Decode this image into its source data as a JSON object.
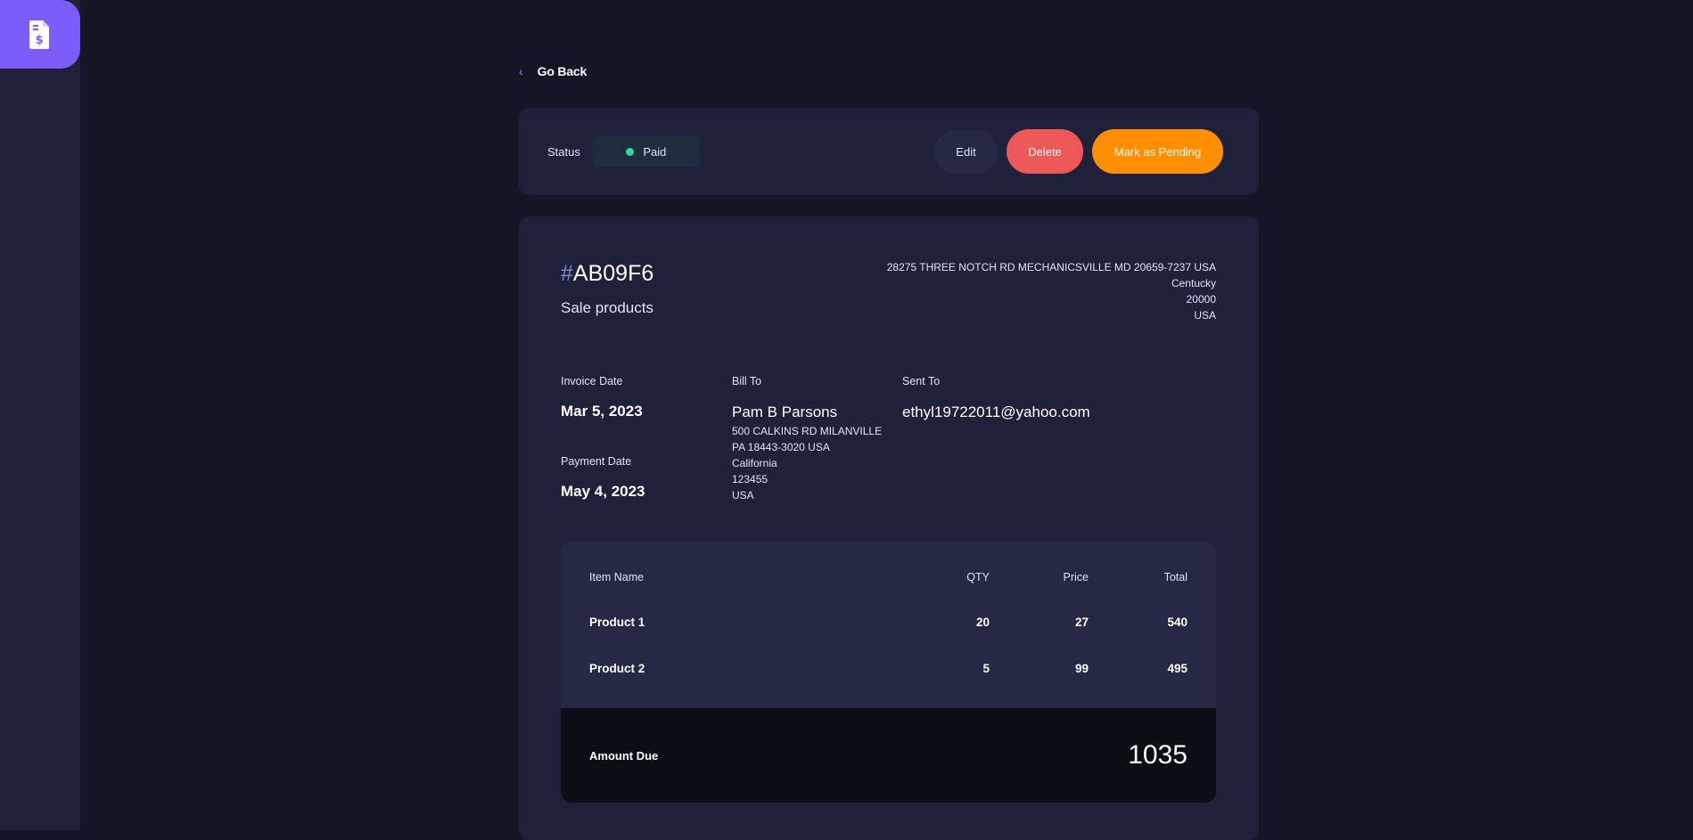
{
  "nav": {
    "back_label": "Go Back"
  },
  "status": {
    "label": "Status",
    "value": "Paid"
  },
  "actions": {
    "edit": "Edit",
    "delete": "Delete",
    "mark": "Mark as Pending"
  },
  "invoice": {
    "hash": "#",
    "id": "AB09F6",
    "description": "Sale products",
    "sender_address": [
      "28275 THREE NOTCH RD MECHANICSVILLE MD 20659-7237 USA",
      "Centucky",
      "20000",
      "USA"
    ],
    "invoice_date_label": "Invoice Date",
    "invoice_date": "Mar 5, 2023",
    "payment_date_label": "Payment Date",
    "payment_date": "May 4, 2023",
    "bill_to_label": "Bill To",
    "bill_to_name": "Pam B Parsons",
    "bill_to_address": [
      "500 CALKINS RD MILANVILLE",
      "PA 18443-3020 USA",
      "California",
      "123455",
      "USA"
    ],
    "sent_to_label": "Sent To",
    "sent_to_email": "ethyl19722011@yahoo.com"
  },
  "items_table": {
    "headers": {
      "name": "Item Name",
      "qty": "QTY",
      "price": "Price",
      "total": "Total"
    },
    "rows": [
      {
        "name": "Product 1",
        "qty": "20",
        "price": "27",
        "total": "540"
      },
      {
        "name": "Product 2",
        "qty": "5",
        "price": "99",
        "total": "495"
      }
    ],
    "amount_due_label": "Amount Due",
    "amount_due": "1035"
  },
  "colors": {
    "accent": "#7c5dfa",
    "paid": "#33d69f",
    "delete": "#ec5757",
    "pending": "#ff8f00"
  },
  "icons": {
    "logo": "invoice-dollar-icon",
    "back": "chevron-left-icon"
  }
}
